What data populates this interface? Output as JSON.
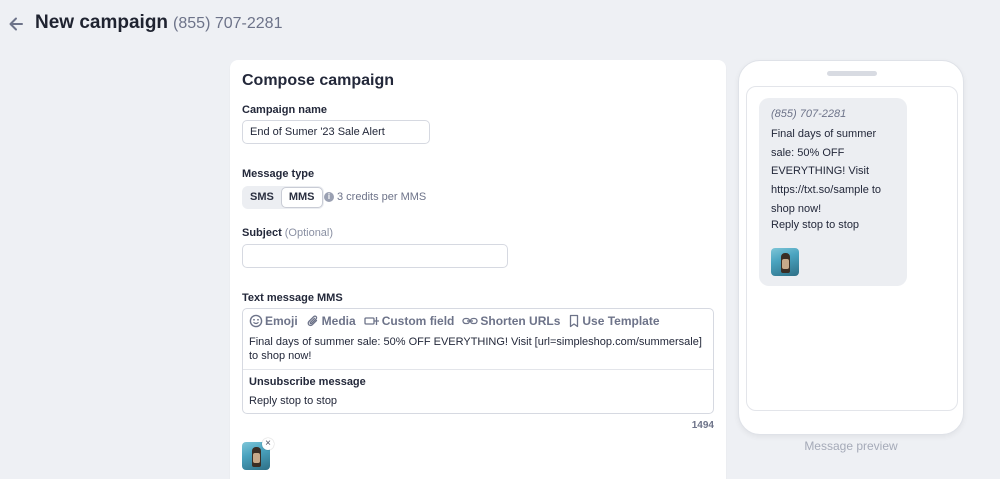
{
  "header": {
    "title": "New campaign",
    "phone": "(855) 707-2281"
  },
  "compose": {
    "title": "Compose campaign",
    "campaign_name_label": "Campaign name",
    "campaign_name_value": "End of Sumer '23 Sale Alert",
    "message_type_label": "Message type",
    "message_types": [
      "SMS",
      "MMS"
    ],
    "selected_message_type": "MMS",
    "credits_note": "3 credits per MMS",
    "subject_label": "Subject",
    "subject_optional": "(Optional)",
    "subject_value": "",
    "text_message_label": "Text message MMS",
    "toolbar": {
      "emoji": "Emoji",
      "media": "Media",
      "custom_field": "Custom field",
      "shorten_urls": "Shorten URLs",
      "use_template": "Use Template"
    },
    "message_body": "Final days of summer sale: 50% OFF EVERYTHING! Visit [url=simpleshop.com/summersale] to shop now!",
    "unsubscribe_label": "Unsubscribe message",
    "unsubscribe_text": "Reply stop to stop",
    "char_count": "1494",
    "remove_icon": "×"
  },
  "preview": {
    "from": "(855) 707-2281",
    "message": "Final days of summer sale: 50% OFF EVERYTHING! Visit https://txt.so/sample to shop now!",
    "stop_text": "Reply stop to stop",
    "caption": "Message preview"
  },
  "icons": {
    "back": "arrow-left-icon",
    "info": "info-icon",
    "emoji": "smile-icon",
    "media": "paperclip-icon",
    "custom_field": "tag-field-icon",
    "shorten_urls": "link-icon",
    "use_template": "bookmark-icon"
  },
  "colors": {
    "background": "#eef0f4",
    "muted_text": "#6d7389",
    "bubble": "#eceef2"
  }
}
